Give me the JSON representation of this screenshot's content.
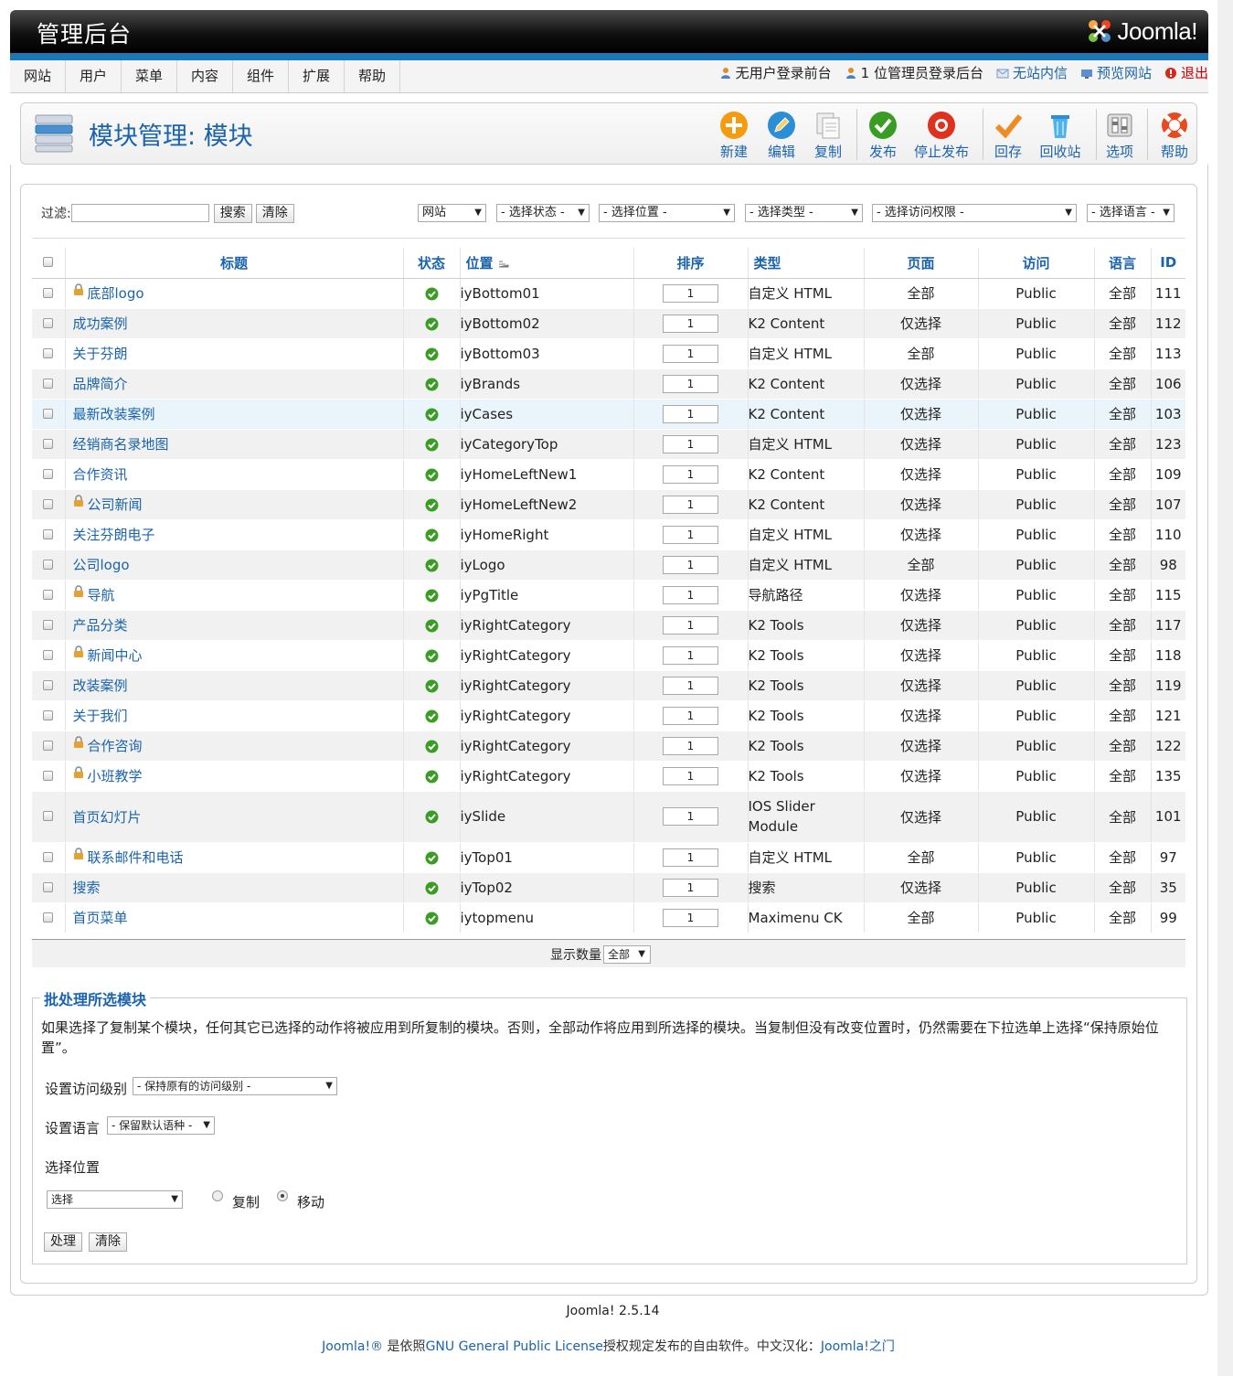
{
  "header": {
    "title": "管理后台",
    "logo_text": "Joomla!"
  },
  "menu": [
    "网站",
    "用户",
    "菜单",
    "内容",
    "组件",
    "扩展",
    "帮助"
  ],
  "status": {
    "frontend_users": "无用户登录前台",
    "backend_admins": "1 位管理员登录后台",
    "messages": "无站内信",
    "preview": "预览网站",
    "logout": "退出"
  },
  "toolbar": {
    "page_title": "模块管理: 模块",
    "new": "新建",
    "edit": "编辑",
    "copy": "复制",
    "publish": "发布",
    "unpublish": "停止发布",
    "checkin": "回存",
    "trash": "回收站",
    "options": "选项",
    "help": "帮助"
  },
  "filters": {
    "label": "过滤:",
    "search_value": "",
    "search_btn": "搜索",
    "clear_btn": "清除",
    "client": "网站",
    "state": "- 选择状态 -",
    "position": "- 选择位置 -",
    "type": "- 选择类型 -",
    "access": "- 选择访问权限 -",
    "language": "- 选择语言 -"
  },
  "columns": {
    "title": "标题",
    "status": "状态",
    "position": "位置",
    "ordering": "排序",
    "type": "类型",
    "pages": "页面",
    "access": "访问",
    "language": "语言",
    "id": "ID"
  },
  "rows": [
    {
      "title": "底部logo",
      "locked": true,
      "position": "iyBottom01",
      "order": "1",
      "type": "自定义 HTML",
      "pages": "全部",
      "access": "Public",
      "language": "全部",
      "id": "111"
    },
    {
      "title": "成功案例",
      "locked": false,
      "position": "iyBottom02",
      "order": "1",
      "type": "K2 Content",
      "pages": "仅选择",
      "access": "Public",
      "language": "全部",
      "id": "112"
    },
    {
      "title": "关于芬朗",
      "locked": false,
      "position": "iyBottom03",
      "order": "1",
      "type": "自定义 HTML",
      "pages": "全部",
      "access": "Public",
      "language": "全部",
      "id": "113"
    },
    {
      "title": "品牌简介",
      "locked": false,
      "position": "iyBrands",
      "order": "1",
      "type": "K2 Content",
      "pages": "仅选择",
      "access": "Public",
      "language": "全部",
      "id": "106"
    },
    {
      "title": "最新改装案例",
      "locked": false,
      "position": "iyCases",
      "order": "1",
      "type": "K2 Content",
      "pages": "仅选择",
      "access": "Public",
      "language": "全部",
      "id": "103"
    },
    {
      "title": "经销商名录地图",
      "locked": false,
      "position": "iyCategoryTop",
      "order": "1",
      "type": "自定义 HTML",
      "pages": "仅选择",
      "access": "Public",
      "language": "全部",
      "id": "123"
    },
    {
      "title": "合作资讯",
      "locked": false,
      "position": "iyHomeLeftNew1",
      "order": "1",
      "type": "K2 Content",
      "pages": "仅选择",
      "access": "Public",
      "language": "全部",
      "id": "109"
    },
    {
      "title": "公司新闻",
      "locked": true,
      "position": "iyHomeLeftNew2",
      "order": "1",
      "type": "K2 Content",
      "pages": "仅选择",
      "access": "Public",
      "language": "全部",
      "id": "107"
    },
    {
      "title": "关注芬朗电子",
      "locked": false,
      "position": "iyHomeRight",
      "order": "1",
      "type": "自定义 HTML",
      "pages": "仅选择",
      "access": "Public",
      "language": "全部",
      "id": "110"
    },
    {
      "title": "公司logo",
      "locked": false,
      "position": "iyLogo",
      "order": "1",
      "type": "自定义 HTML",
      "pages": "全部",
      "access": "Public",
      "language": "全部",
      "id": "98"
    },
    {
      "title": "导航",
      "locked": true,
      "position": "iyPgTitle",
      "order": "1",
      "type": "导航路径",
      "pages": "仅选择",
      "access": "Public",
      "language": "全部",
      "id": "115"
    },
    {
      "title": "产品分类",
      "locked": false,
      "position": "iyRightCategory",
      "order": "1",
      "type": "K2 Tools",
      "pages": "仅选择",
      "access": "Public",
      "language": "全部",
      "id": "117"
    },
    {
      "title": "新闻中心",
      "locked": true,
      "position": "iyRightCategory",
      "order": "1",
      "type": "K2 Tools",
      "pages": "仅选择",
      "access": "Public",
      "language": "全部",
      "id": "118"
    },
    {
      "title": "改装案例",
      "locked": false,
      "position": "iyRightCategory",
      "order": "1",
      "type": "K2 Tools",
      "pages": "仅选择",
      "access": "Public",
      "language": "全部",
      "id": "119"
    },
    {
      "title": "关于我们",
      "locked": false,
      "position": "iyRightCategory",
      "order": "1",
      "type": "K2 Tools",
      "pages": "仅选择",
      "access": "Public",
      "language": "全部",
      "id": "121"
    },
    {
      "title": "合作咨询",
      "locked": true,
      "position": "iyRightCategory",
      "order": "1",
      "type": "K2 Tools",
      "pages": "仅选择",
      "access": "Public",
      "language": "全部",
      "id": "122"
    },
    {
      "title": "小班教学",
      "locked": true,
      "position": "iyRightCategory",
      "order": "1",
      "type": "K2 Tools",
      "pages": "仅选择",
      "access": "Public",
      "language": "全部",
      "id": "135"
    },
    {
      "title": "首页幻灯片",
      "locked": false,
      "position": "iySlide",
      "order": "1",
      "type": "IOS Slider Module",
      "pages": "仅选择",
      "access": "Public",
      "language": "全部",
      "id": "101"
    },
    {
      "title": "联系邮件和电话",
      "locked": true,
      "position": "iyTop01",
      "order": "1",
      "type": "自定义 HTML",
      "pages": "全部",
      "access": "Public",
      "language": "全部",
      "id": "97"
    },
    {
      "title": "搜索",
      "locked": false,
      "position": "iyTop02",
      "order": "1",
      "type": "搜索",
      "pages": "仅选择",
      "access": "Public",
      "language": "全部",
      "id": "35"
    },
    {
      "title": "首页菜单",
      "locked": false,
      "position": "iytopmenu",
      "order": "1",
      "type": "Maximenu CK",
      "pages": "全部",
      "access": "Public",
      "language": "全部",
      "id": "99"
    }
  ],
  "pager": {
    "label": "显示数量",
    "value": "全部"
  },
  "batch": {
    "legend": "批处理所选模块",
    "description": "如果选择了复制某个模块，任何其它已选择的动作将被应用到所复制的模块。否则，全部动作将应用到所选择的模块。当复制但没有改变位置时，仍然需要在下拉选单上选择“保持原始位置”。",
    "access_label": "设置访问级别",
    "access_value": "- 保持原有的访问级别 -",
    "language_label": "设置语言",
    "language_value": "- 保留默认语种 -",
    "position_label": "选择位置",
    "position_value": "选择",
    "copy_label": "复制",
    "move_label": "移动",
    "process_btn": "处理",
    "clear_btn": "清除"
  },
  "footer": {
    "version": "Joomla! 2.5.14",
    "copy_prefix": "Joomla!®",
    "copy_mid1": " 是依照",
    "license": "GNU General Public License",
    "copy_mid2": "授权规定发布的自由软件。中文汉化：",
    "cn_link": "Joomla!之门"
  },
  "colors": {
    "accent": "#1a63ad",
    "header_bar": "#1e77b5",
    "ok": "#3a9d23"
  }
}
